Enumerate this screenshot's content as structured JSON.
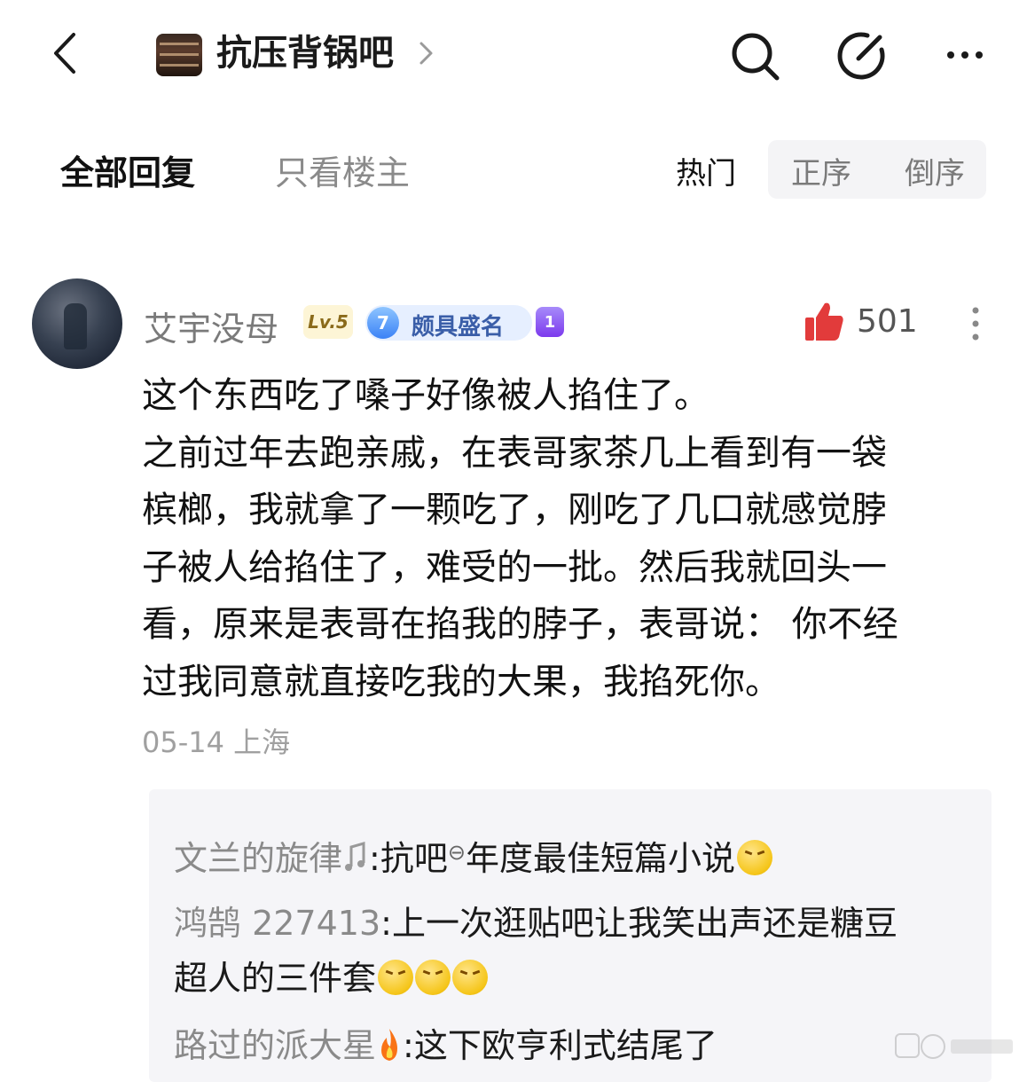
{
  "header": {
    "forum_name": "抗压背锅吧"
  },
  "tabs": {
    "all_replies": "全部回复",
    "op_only": "只看楼主",
    "sort_hot": "热门",
    "sort_asc": "正序",
    "sort_desc": "倒序"
  },
  "comment": {
    "username": "艾宇没母",
    "level": "Lv.5",
    "honor_level": "7",
    "honor_title": "颇具盛名",
    "rank": "1",
    "likes": "501",
    "lines": [
      "这个东西吃了嗓子好像被人掐住了。",
      "之前过年去跑亲戚，在表哥家茶几上看到有一袋",
      "槟榔，我就拿了一颗吃了，刚吃了几口就感觉脖",
      "子被人给掐住了，难受的一批。然后我就回头一",
      "看，原来是表哥在掐我的脖子，表哥说： 你不经",
      "过我同意就直接吃我的大果，我掐死你。"
    ],
    "date": "05-14",
    "location": "上海"
  },
  "replies": [
    {
      "name": "文兰的旋律",
      "text_a": "抗吧",
      "text_b": "年度最佳短篇小说"
    },
    {
      "name": "鸿鹄 227413",
      "text": "上一次逛贴吧让我笑出声还是糖豆",
      "text_cont": "超人的三件套"
    },
    {
      "name": "路过的派大星",
      "text": "这下欧亨利式结尾了"
    }
  ],
  "icons": {
    "back": "chevron-left-icon",
    "search": "search-icon",
    "edit": "edit-icon",
    "more": "more-icon",
    "like": "thumbs-up-icon",
    "comment_more": "vertical-more-icon"
  },
  "colors": {
    "like_red": "#e23b3b",
    "meta_gray": "#a0a0a0",
    "reply_bg": "#f5f5f8"
  }
}
